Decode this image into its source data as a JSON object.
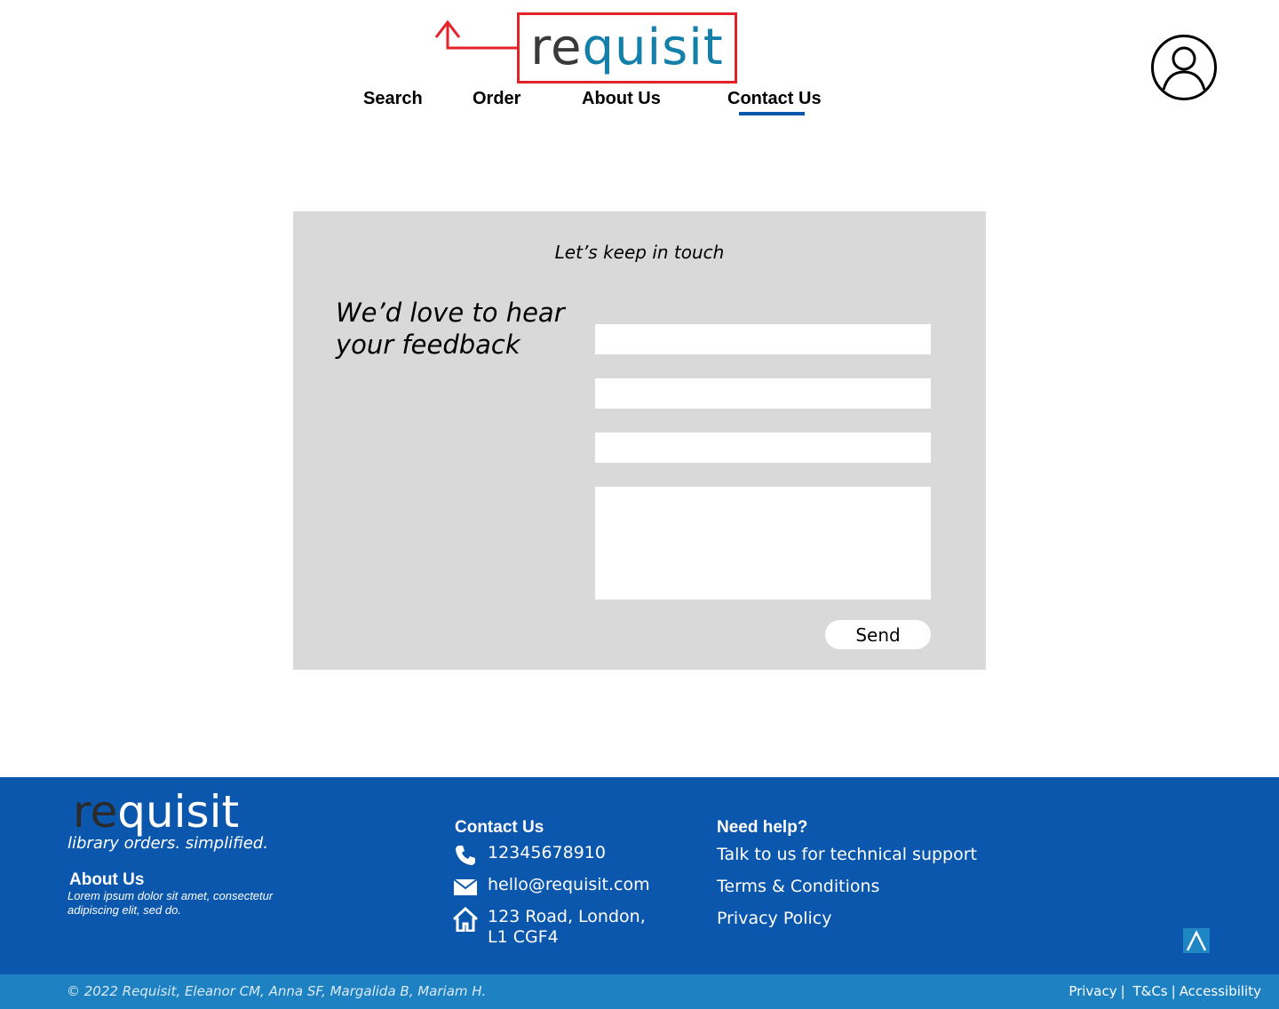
{
  "header": {
    "logo": {
      "prefix": "re",
      "rest": "quisit"
    },
    "nav": [
      {
        "label": "Search"
      },
      {
        "label": "Order"
      },
      {
        "label": "About Us"
      },
      {
        "label": "Contact Us",
        "active": true
      }
    ],
    "user_icon": "user-account-icon",
    "annotation_color": "#e3222a"
  },
  "contact": {
    "heading": "Let’s keep in touch",
    "tagline": "We’d love to hear your feedback",
    "send_label": "Send"
  },
  "footer": {
    "logo": {
      "prefix": "re",
      "rest": "quisit"
    },
    "tagline": "library orders. simplified.",
    "about_title": "About Us",
    "about_text": "Lorem ipsum dolor sit amet, consectetur adipiscing elit, sed do.",
    "contact_title": "Contact Us",
    "phone": "12345678910",
    "email": "hello@requisit.com",
    "address_line1": "123 Road, London,",
    "address_line2": "L1 CGF4",
    "help_title": "Need help?",
    "help_links": [
      {
        "label": "Talk to us for technical support"
      },
      {
        "label": "Terms & Conditions"
      },
      {
        "label": "Privacy Policy"
      }
    ],
    "back_to_top_icon": "chevron-up-icon",
    "copyright": "© 2022 Requisit, Eleanor CM, Anna SF, Margalida B, Mariam H.",
    "legal_links": [
      {
        "label": "Privacy"
      },
      {
        "label": "T&Cs"
      },
      {
        "label": "Accessibility"
      }
    ]
  },
  "colors": {
    "brand_blue": "#0b57ad",
    "brand_teal": "#147fa8",
    "footer_bar": "#1d81c2",
    "panel_gray": "#d9d9d9"
  }
}
